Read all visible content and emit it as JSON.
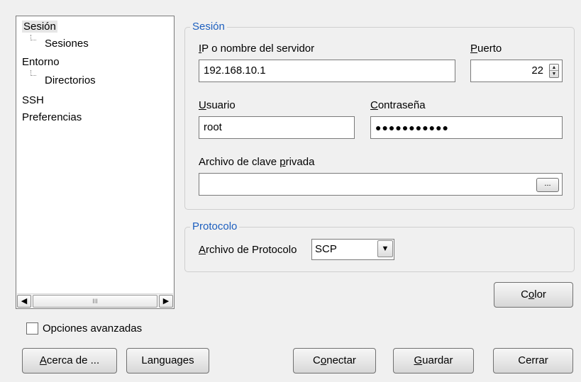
{
  "tree": {
    "items": [
      {
        "label": "Sesión"
      },
      {
        "label": "Sesiones"
      },
      {
        "label": "Entorno"
      },
      {
        "label": "Directorios"
      },
      {
        "label": "SSH"
      },
      {
        "label": "Preferencias"
      }
    ],
    "scroll_thumb_label": "III"
  },
  "session_group": {
    "title": "Sesión",
    "host_label": "IP o nombre del servidor",
    "host_value": "192.168.10.1",
    "port_label": "Puerto",
    "port_value": "22",
    "user_label": "Usuario",
    "user_value": "root",
    "password_label": "Contraseña",
    "password_value": "●●●●●●●●●●●",
    "keyfile_label": "Archivo de clave privada",
    "keyfile_value": "",
    "browse_label": "..."
  },
  "protocol_group": {
    "title": "Protocolo",
    "file_protocol_label": "Archivo de Protocolo",
    "file_protocol_value": "SCP"
  },
  "advanced_options_label": "Opciones avanzadas",
  "buttons": {
    "color": "Color",
    "about": "Acerca de ...",
    "languages": "Languages",
    "connect": "Conectar",
    "save": "Guardar",
    "close": "Cerrar"
  }
}
